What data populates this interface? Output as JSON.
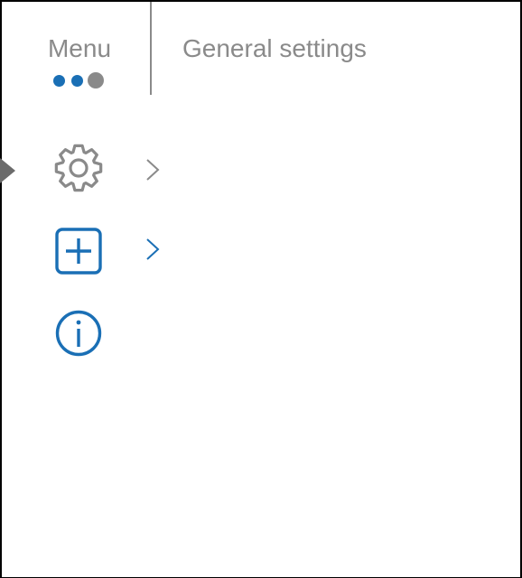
{
  "header": {
    "menu_label": "Menu",
    "section_title": "General settings",
    "page_dots": [
      {
        "state": "visited",
        "color": "#1a6fb5"
      },
      {
        "state": "visited",
        "color": "#1a6fb5"
      },
      {
        "state": "current",
        "color": "#8a8a8a"
      }
    ]
  },
  "menu": {
    "items": [
      {
        "icon": "gear-icon",
        "selected": true,
        "has_submenu": true,
        "color": "#8a8a8a"
      },
      {
        "icon": "plus-square-icon",
        "selected": false,
        "has_submenu": true,
        "color": "#1a6fb5"
      },
      {
        "icon": "info-circle-icon",
        "selected": false,
        "has_submenu": false,
        "color": "#1a6fb5"
      }
    ]
  },
  "colors": {
    "accent": "#1a6fb5",
    "muted": "#8a8a8a",
    "selector": "#6b6b6b",
    "background": "#ffffff"
  }
}
